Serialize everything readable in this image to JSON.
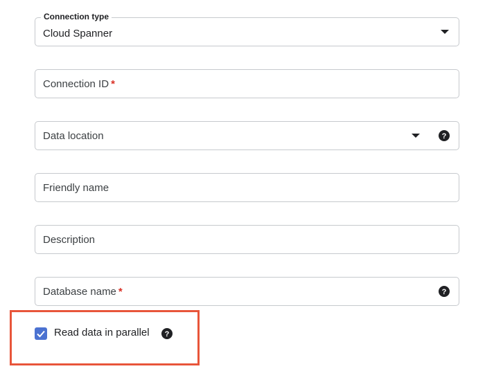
{
  "form": {
    "connection_type": {
      "label": "Connection type",
      "value": "Cloud Spanner"
    },
    "connection_id": {
      "label": "Connection ID",
      "required_mark": "*"
    },
    "data_location": {
      "label": "Data location"
    },
    "friendly_name": {
      "label": "Friendly name"
    },
    "description": {
      "label": "Description"
    },
    "database_name": {
      "label": "Database name",
      "required_mark": "*"
    },
    "read_parallel": {
      "label": "Read data in parallel",
      "checked": true
    }
  },
  "colors": {
    "required": "#d93025",
    "checkbox": "#4b72d1",
    "highlight": "#e8553a"
  },
  "icons": [
    "chevron-down-icon",
    "help-icon",
    "checkmark-icon"
  ]
}
